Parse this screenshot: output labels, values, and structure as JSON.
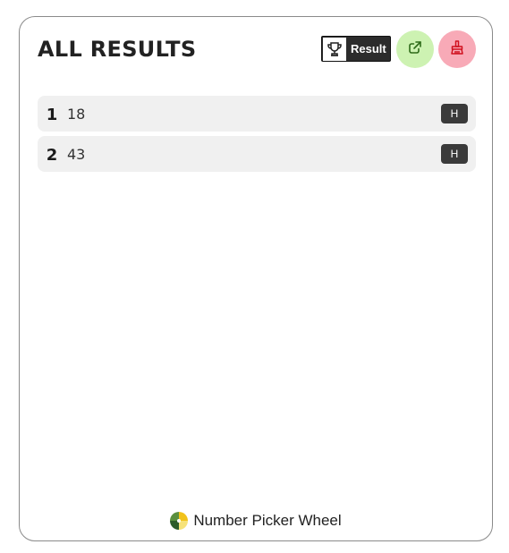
{
  "header": {
    "title": "ALL RESULTS",
    "result_button_label": "Result",
    "result_icon": "trophy-icon",
    "share_icon": "external-link-icon",
    "clear_icon": "broom-icon"
  },
  "results": [
    {
      "index": "1",
      "value": "18",
      "hide_label": "H"
    },
    {
      "index": "2",
      "value": "43",
      "hide_label": "H"
    }
  ],
  "footer": {
    "brand": "Number Picker Wheel",
    "logo_icon": "wheel-logo-icon"
  },
  "colors": {
    "share_bg": "#cdf2b2",
    "clear_bg": "#f8aab7",
    "row_bg": "#f0f0f0",
    "badge_bg": "#3a3a3a"
  }
}
